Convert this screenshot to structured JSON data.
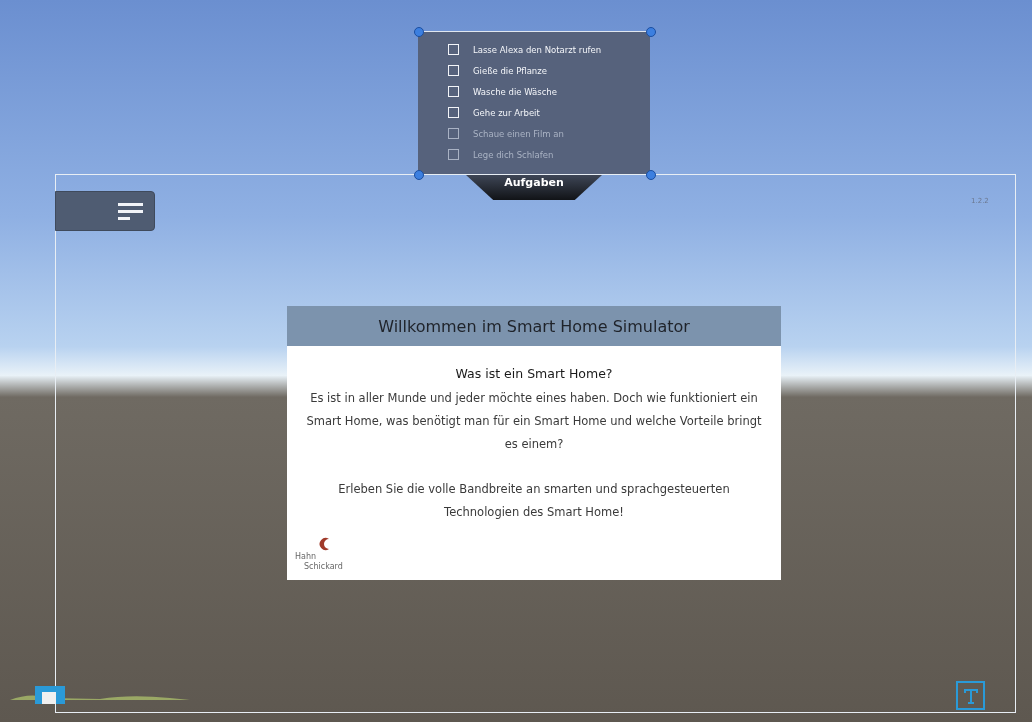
{
  "tasks": {
    "items": [
      {
        "label": "Lasse Alexa den Notarzt rufen",
        "checked": false,
        "disabled": false
      },
      {
        "label": "Gieße die Pflanze",
        "checked": false,
        "disabled": false
      },
      {
        "label": "Wasche die Wäsche",
        "checked": false,
        "disabled": false
      },
      {
        "label": "Gehe zur Arbeit",
        "checked": false,
        "disabled": false
      },
      {
        "label": "Schaue einen Film an",
        "checked": false,
        "disabled": true
      },
      {
        "label": "Lege dich Schlafen",
        "checked": false,
        "disabled": true
      }
    ],
    "tab": "Aufgaben"
  },
  "version": "1.2.2",
  "welcome": {
    "title": "Willkommen im Smart Home Simulator",
    "heading": "Was ist ein Smart Home?",
    "paragraphs": [
      "Es ist in aller Munde und jeder möchte eines haben. Doch wie funktioniert ein Smart Home, was benötigt man für ein Smart Home und welche Vorteile bringt es einem?",
      "Erleben Sie die volle Bandbreite an smarten und sprachgesteuerten Technologien des Smart Home!"
    ],
    "logo": [
      "Hahn",
      "Schickard"
    ]
  }
}
